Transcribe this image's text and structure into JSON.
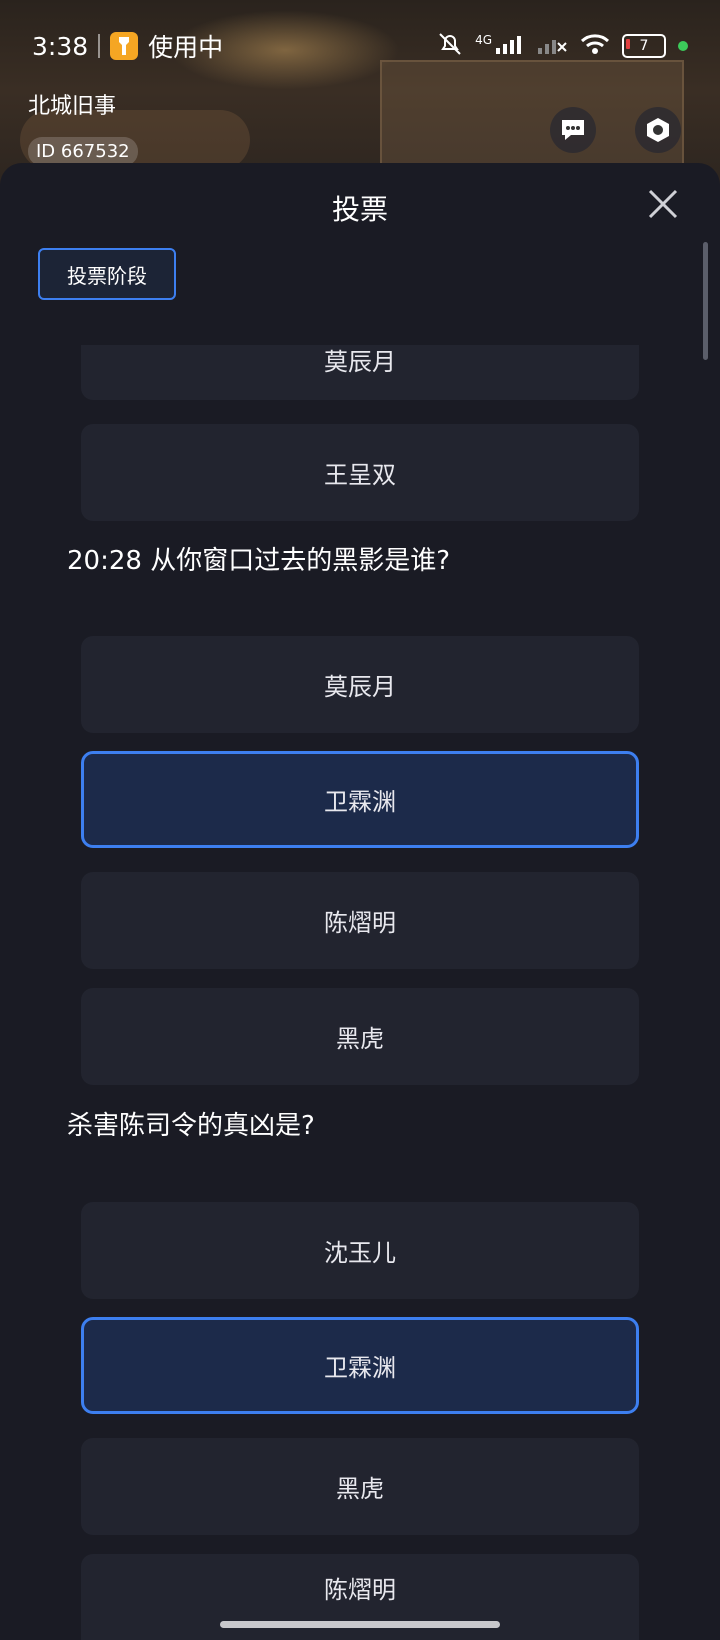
{
  "status_bar": {
    "time": "3:38",
    "app_badge": "使用中",
    "network": "4G",
    "battery": "7"
  },
  "room": {
    "title": "北城旧事",
    "id": "ID 667532"
  },
  "sheet": {
    "title": "投票",
    "phase_label": "投票阶段",
    "partial_top_option": "莫辰月",
    "prev_last_option": "王呈双",
    "questions": [
      {
        "text": "20:28 从你窗口过去的黑影是谁?",
        "options": [
          {
            "label": "莫辰月",
            "selected": false
          },
          {
            "label": "卫霖渊",
            "selected": true
          },
          {
            "label": "陈熠明",
            "selected": false
          },
          {
            "label": "黑虎",
            "selected": false
          }
        ]
      },
      {
        "text": "杀害陈司令的真凶是?",
        "options": [
          {
            "label": "沈玉儿",
            "selected": false
          },
          {
            "label": "卫霖渊",
            "selected": true
          },
          {
            "label": "黑虎",
            "selected": false
          },
          {
            "label": "陈熠明",
            "selected": false
          }
        ]
      }
    ]
  },
  "colors": {
    "accent": "#3d7ff0",
    "sheet_bg": "#1a1b24",
    "option_bg": "#22242f",
    "selected_bg": "#1c2a4a"
  }
}
